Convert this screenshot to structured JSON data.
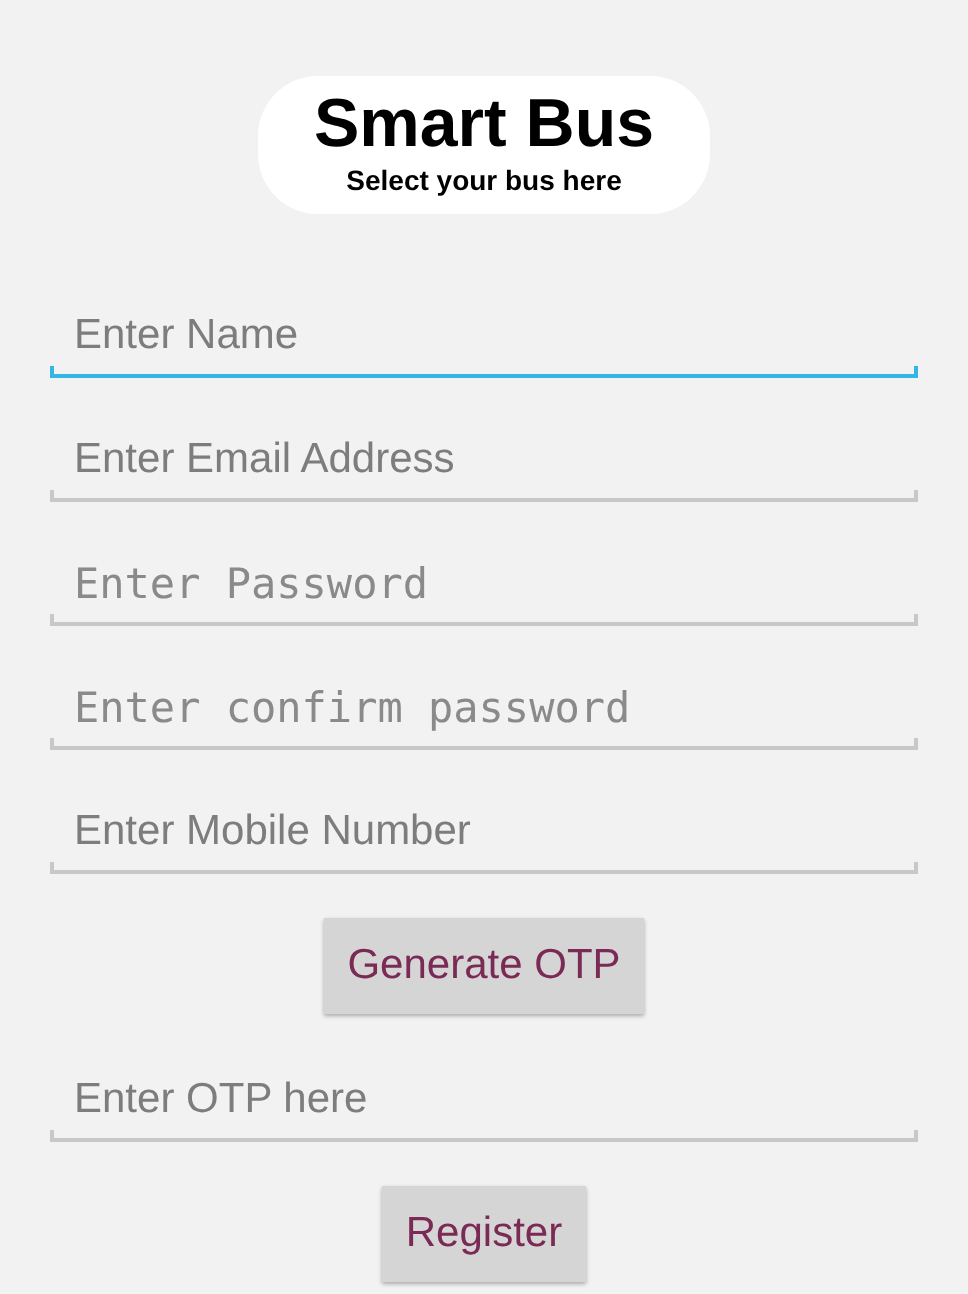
{
  "header": {
    "title": "Smart Bus",
    "subtitle": "Select your bus here"
  },
  "items": [
    {
      "kind": "field",
      "placeholder": "Enter Name",
      "password": false,
      "focused": true
    },
    {
      "kind": "field",
      "placeholder": "Enter Email Address",
      "password": false,
      "focused": false
    },
    {
      "kind": "field",
      "placeholder": "Enter Password",
      "password": true,
      "focused": false
    },
    {
      "kind": "field",
      "placeholder": "Enter confirm password",
      "password": true,
      "focused": false
    },
    {
      "kind": "field",
      "placeholder": "Enter Mobile Number",
      "password": false,
      "focused": false
    },
    {
      "kind": "button",
      "label": "Generate OTP"
    },
    {
      "kind": "field",
      "placeholder": "Enter OTP here",
      "password": false,
      "focused": false
    },
    {
      "kind": "button",
      "label": "Register"
    }
  ]
}
